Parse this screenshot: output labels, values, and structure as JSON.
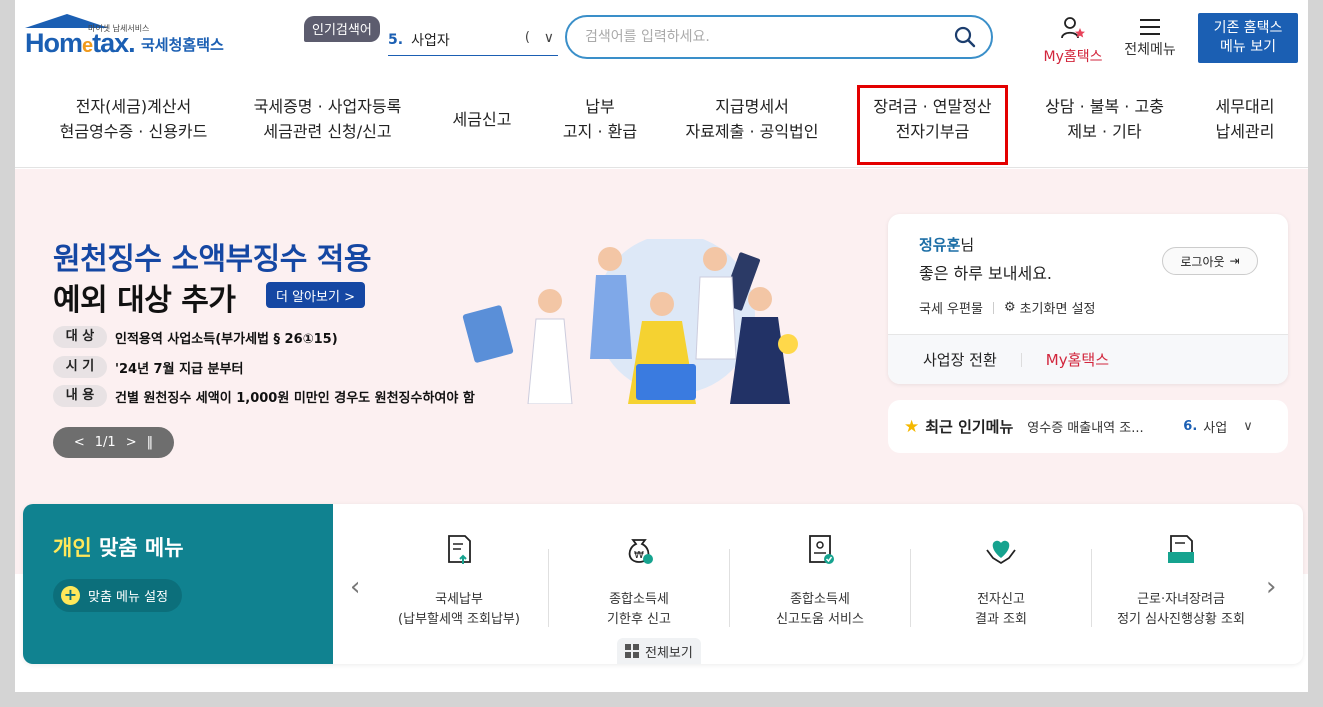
{
  "header": {
    "logo_small_text": "마이셋 납세서비스",
    "logo_main": "Hom",
    "logo_e": "e",
    "logo_tax": "tax.",
    "logo_kor": "국세청홈택스",
    "popular_badge": "인기검색어",
    "popular_num": "5.",
    "popular_value": "사업자",
    "search_placeholder": "검색어를 입력하세요.",
    "my_hometax": "My홈택스",
    "all_menu": "전체메뉴",
    "old_hometax_line1": "기존 홈택스",
    "old_hometax_line2": "메뉴 보기"
  },
  "gnb": [
    {
      "line1": "전자(세금)계산서",
      "line2": "현금영수증 · 신용카드"
    },
    {
      "line1": "국세증명 · 사업자등록",
      "line2": "세금관련 신청/신고"
    },
    {
      "line1": "세금신고",
      "line2": ""
    },
    {
      "line1": "납부",
      "line2": "고지 · 환급"
    },
    {
      "line1": "지급명세서",
      "line2": "자료제출 · 공익법인"
    },
    {
      "line1": "장려금 · 연말정산",
      "line2": "전자기부금"
    },
    {
      "line1": "상담 · 불복 · 고충",
      "line2": "제보 · 기타"
    },
    {
      "line1": "세무대리",
      "line2": "납세관리"
    }
  ],
  "banner": {
    "title1": "원천징수 소액부징수 적용",
    "title2": "예외 대상 추가",
    "more": "더 알아보기",
    "rows": [
      {
        "tag": "대 상",
        "text": "인적용역 사업소득(부가세법 § 26①15)"
      },
      {
        "tag": "시 기",
        "text": "'24년 7월 지급 분부터"
      },
      {
        "tag": "내 용",
        "text": "건별 원천징수 세액이 1,000원 미만인 경우도 원천징수하여야 함"
      }
    ],
    "pager": "1/1"
  },
  "login": {
    "name": "정유훈",
    "suffix": "님",
    "greeting": "좋은 하루 보내세요.",
    "logout": "로그아웃",
    "mailbox": "국세 우편물",
    "home_setting": "초기화면 설정",
    "switch_biz": "사업장 전환",
    "my_hometax": "My홈택스"
  },
  "recent": {
    "title": "최근 인기메뉴",
    "item": "영수증 매출내역 조...",
    "num": "6.",
    "value": "사업"
  },
  "custom_menu": {
    "title_highlight": "개인",
    "title_rest": " 맞춤 메뉴",
    "setting_button": "맞춤 메뉴 설정",
    "items": [
      {
        "line1": "국세납부",
        "line2": "(납부할세액 조회납부)",
        "icon": "document-upload-icon"
      },
      {
        "line1": "종합소득세",
        "line2": "기한후 신고",
        "icon": "money-bag-icon"
      },
      {
        "line1": "종합소득세",
        "line2": "신고도움 서비스",
        "icon": "document-check-icon"
      },
      {
        "line1": "전자신고",
        "line2": "결과 조회",
        "icon": "heart-hands-icon"
      },
      {
        "line1": "근로·자녀장려금",
        "line2": "정기 심사진행상황 조회",
        "icon": "folder-document-icon"
      }
    ],
    "view_all": "전체보기"
  },
  "colors": {
    "brand_blue": "#1b5fb3",
    "teal": "#108290",
    "accent_red": "#d2263c",
    "highlight_red": "#e30000",
    "banner_bg": "#fcf0f1"
  }
}
